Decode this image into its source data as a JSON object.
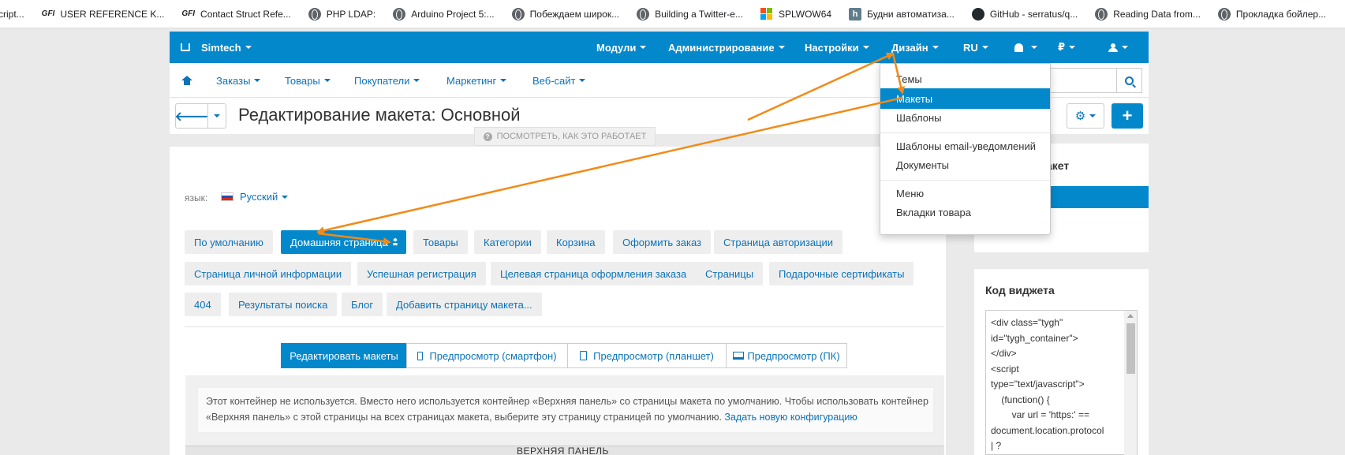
{
  "bookmarks": [
    {
      "label": "cript...",
      "icon": "none"
    },
    {
      "label": "USER REFERENCE K...",
      "icon": "GFI"
    },
    {
      "label": "Contact Struct Refe...",
      "icon": "GFI"
    },
    {
      "label": "PHP LDAP:",
      "icon": "globe-icon"
    },
    {
      "label": "Arduino Project 5:...",
      "icon": "globe-icon"
    },
    {
      "label": "Побеждаем широк...",
      "icon": "globe-icon"
    },
    {
      "label": "Building a Twitter-e...",
      "icon": "globe-icon"
    },
    {
      "label": "SPLWOW64",
      "icon": "ms-icon"
    },
    {
      "label": "Будни автоматиза...",
      "icon": "h-icon"
    },
    {
      "label": "GitHub - serratus/q...",
      "icon": "github-icon"
    },
    {
      "label": "Reading Data from...",
      "icon": "globe-icon"
    },
    {
      "label": "Прокладка бойлер...",
      "icon": "globe-icon"
    }
  ],
  "bookmarks_more": "»",
  "topnav": {
    "brand": "Simtech",
    "modules": "Модули",
    "admin": "Администрирование",
    "settings": "Настройки",
    "design": "Дизайн",
    "lang": "RU",
    "currency": "₽"
  },
  "subnav": {
    "orders": "Заказы",
    "products": "Товары",
    "customers": "Покупатели",
    "marketing": "Маркетинг",
    "website": "Веб-сайт"
  },
  "title": {
    "back": "🡐",
    "text": "Редактирование макета: Основной",
    "howto": "ПОСМОТРЕТЬ, КАК ЭТО РАБОТАЕТ",
    "plus": "+"
  },
  "language": {
    "label": "язык:",
    "value": "Русский"
  },
  "layout_tabs": [
    {
      "label": "По умолчанию"
    },
    {
      "label": "Домашняя страница"
    },
    {
      "label": "Товары"
    },
    {
      "label": "Категории"
    },
    {
      "label": "Корзина"
    },
    {
      "label": "Оформить заказ"
    },
    {
      "label": "Страница авторизации"
    },
    {
      "label": "Страница личной информации"
    },
    {
      "label": "Успешная регистрация"
    },
    {
      "label": "Целевая страница оформления заказа"
    },
    {
      "label": "Страницы"
    },
    {
      "label": "Подарочные сертификаты"
    },
    {
      "label": "404"
    },
    {
      "label": "Результаты поиска"
    },
    {
      "label": "Блог"
    },
    {
      "label": "Добавить страницу макета..."
    }
  ],
  "view_buttons": {
    "edit": "Редактировать макеты",
    "phone": "Предпросмотр (смартфон)",
    "tablet": "Предпросмотр (планшет)",
    "pc": "Предпросмотр (ПК)"
  },
  "notice": {
    "text": "Этот контейнер не используется. Вместо него используется контейнер «Верхняя панель» со страницы макета по умолчанию. Чтобы использовать контейнер «Верхняя панель» с этой страницы на всех страницах макета, выберите эту страницу страницей по умолчанию.",
    "link": "Задать новую конфигурацию"
  },
  "grid_header": "ВЕРХНЯЯ ПАНЕЛЬ",
  "sidebar": {
    "title1": "акет",
    "widget_title": "Код виджета",
    "code": "<div class=\"tygh\"\nid=\"tygh_container\">\n</div>\n<script\ntype=\"text/javascript\">\n    (function() {\n        var url = 'https:' ==\ndocument.location.protocol\n| ?"
  },
  "design_menu": {
    "themes": "Темы",
    "layouts": "Макеты",
    "templates": "Шаблоны",
    "email_templates": "Шаблоны email-уведомлений",
    "documents": "Документы",
    "menus": "Меню",
    "product_tabs": "Вкладки товара"
  },
  "colors": {
    "accent": "#0388cc",
    "link": "#0b73b9",
    "annotation": "#f28a18"
  }
}
